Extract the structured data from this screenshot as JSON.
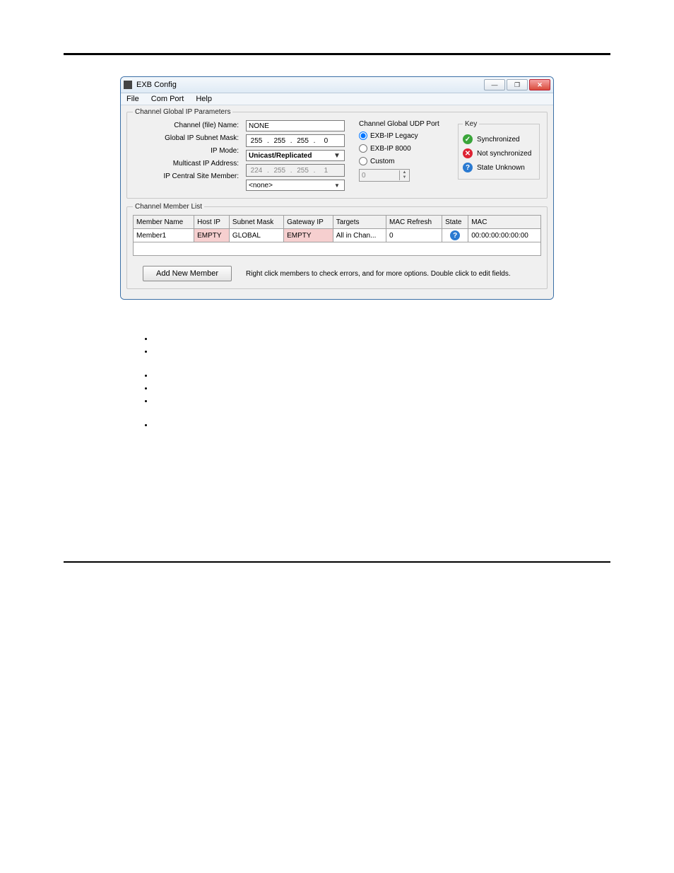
{
  "window": {
    "title": "EXB Config",
    "min_btn_glyph": "—",
    "max_btn_glyph": "❐",
    "close_btn_glyph": "✕"
  },
  "menubar": {
    "file": "File",
    "com_port": "Com Port",
    "help": "Help"
  },
  "params": {
    "legend": "Channel Global IP Parameters",
    "labels": {
      "channel_name": "Channel (file) Name:",
      "subnet_mask": "Global IP Subnet Mask:",
      "ip_mode": "IP Mode:",
      "multicast": "Multicast IP Address:",
      "central_site": "IP Central Site Member:"
    },
    "values": {
      "channel_name": "NONE",
      "subnet_oct1": "255",
      "subnet_oct2": "255",
      "subnet_oct3": "255",
      "subnet_oct4": "0",
      "ip_mode": "Unicast/Replicated",
      "mcast_oct1": "224",
      "mcast_oct2": "255",
      "mcast_oct3": "255",
      "mcast_oct4": "1",
      "central_site": "<none>"
    }
  },
  "udp": {
    "legend": "Channel Global UDP Port",
    "opt_legacy": "EXB-IP Legacy",
    "opt_8000": "EXB-IP 8000",
    "opt_custom": "Custom",
    "custom_value": "0"
  },
  "key": {
    "legend": "Key",
    "sync": "Synchronized",
    "notsync": "Not synchronized",
    "unknown": "State Unknown"
  },
  "member_list": {
    "legend": "Channel Member List",
    "headers": {
      "name": "Member Name",
      "host": "Host IP",
      "subnet": "Subnet Mask",
      "gateway": "Gateway IP",
      "targets": "Targets",
      "mac_refresh": "MAC Refresh",
      "state": "State",
      "mac": "MAC"
    },
    "rows": [
      {
        "name": "Member1",
        "host": "EMPTY",
        "subnet": "GLOBAL",
        "gateway": "EMPTY",
        "targets": "All in Chan...",
        "mac_refresh": "0",
        "mac": "00:00:00:00:00:00"
      }
    ],
    "add_btn": "Add New Member",
    "hint": "Right click members to check errors, and for more options.  Double click to edit fields."
  }
}
